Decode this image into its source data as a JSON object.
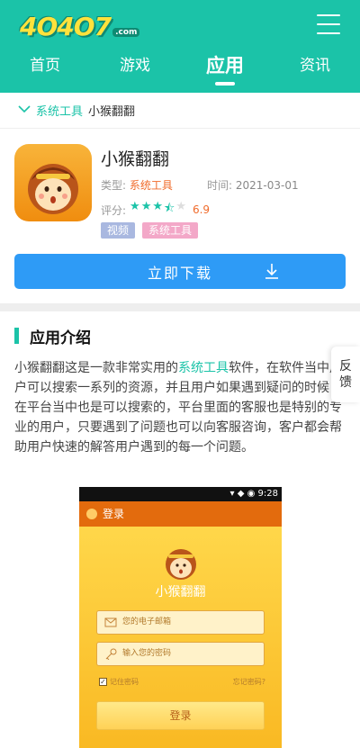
{
  "header": {
    "logo_text": "4O4O7",
    "logo_suffix": ".com",
    "nav": [
      {
        "label": "首页",
        "active": false
      },
      {
        "label": "游戏",
        "active": false
      },
      {
        "label": "应用",
        "active": true
      },
      {
        "label": "资讯",
        "active": false
      }
    ]
  },
  "breadcrumb": {
    "icon": "chevron-down-icon",
    "category": "系统工具",
    "current": "小猴翻翻"
  },
  "app": {
    "name": "小猴翻翻",
    "type_label": "类型:",
    "type_value": "系统工具",
    "time_label": "时间:",
    "time_value": "2021-03-01",
    "score_label": "评分:",
    "rating": 3.5,
    "rating_max": 5,
    "score_value": "6.9",
    "tags": [
      "视频",
      "系统工具"
    ],
    "download_label": "立即下载"
  },
  "intro": {
    "title": "应用介绍",
    "text_before": "小猴翻翻这是一款非常实用的",
    "link": "系统工具",
    "text_after": "软件，在软件当中用户可以搜索一系列的资源，并且用户如果遇到疑问的时候，在平台当中也是可以搜索的，平台里面的客服也是特别的专业的用户，只要遇到了问题也可以向客服咨询，客户都会帮助用户快速的解答用户遇到的每一个问题。"
  },
  "feedback": {
    "label_1": "反",
    "label_2": "馈"
  },
  "screenshot": {
    "status_time": "9:28",
    "bar_title": "登录",
    "app_name": "小猴翻翻",
    "email_placeholder": "您的电子邮箱",
    "password_placeholder": "输入您的密码",
    "remember": "记住密码",
    "forgot": "忘记密码?",
    "login": "登录"
  },
  "colors": {
    "brand": "#1bc3a8",
    "download": "#2e9bf6",
    "accent": "#f06b2b"
  }
}
